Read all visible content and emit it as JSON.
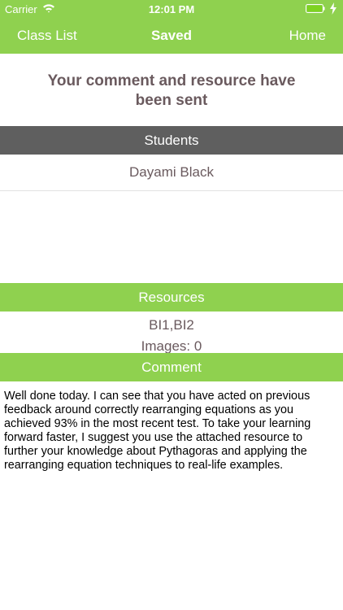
{
  "status_bar": {
    "carrier": "Carrier",
    "time": "12:01 PM",
    "icons": [
      "wifi-icon",
      "battery-icon",
      "charging-icon"
    ]
  },
  "nav": {
    "left_label": "Class List",
    "title": "Saved",
    "right_label": "Home"
  },
  "headline": "Your comment and resource have been sent",
  "students": {
    "header": "Students",
    "items": [
      "Dayami  Black"
    ]
  },
  "resources": {
    "header": "Resources",
    "list": "BI1,BI2",
    "images": "Images: 0"
  },
  "comment": {
    "header": "Comment",
    "text": "Well done today. I can see that you have acted on previous feedback around correctly rearranging equations as you achieved 93% in the most recent test. To take your learning forward faster, I suggest you use the attached resource to further your knowledge about Pythagoras and applying the rearranging equation techniques to real-life examples."
  },
  "colors": {
    "accent": "#8fd14f",
    "students_header": "#5f5f5f",
    "body_text": "#6a5a5e",
    "battery": "#7ed321"
  }
}
